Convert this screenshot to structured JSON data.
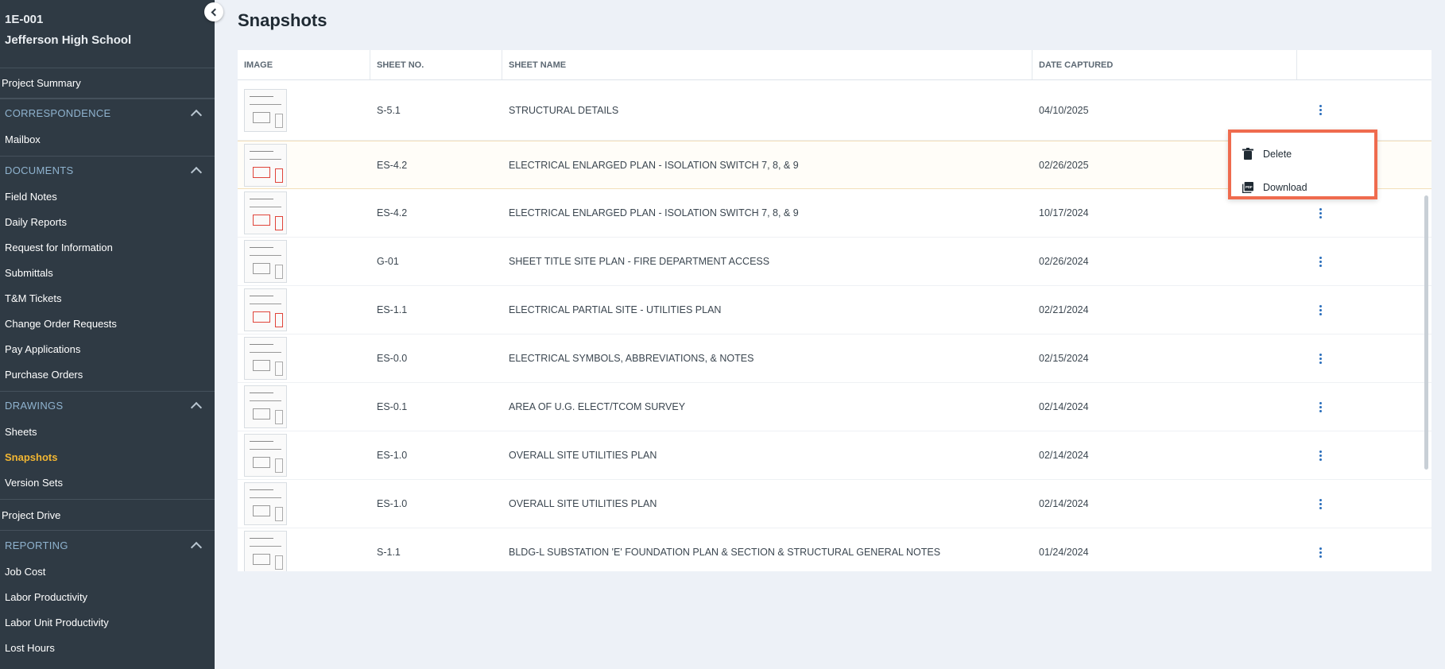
{
  "project": {
    "code": "1E-001",
    "name": "Jefferson High School"
  },
  "nav": {
    "project_summary": "Project Summary",
    "correspondence": {
      "title": "CORRESPONDENCE",
      "items": [
        "Mailbox"
      ]
    },
    "documents": {
      "title": "DOCUMENTS",
      "items": [
        "Field Notes",
        "Daily Reports",
        "Request for Information",
        "Submittals",
        "T&M Tickets",
        "Change Order Requests",
        "Pay Applications",
        "Purchase Orders"
      ]
    },
    "drawings": {
      "title": "DRAWINGS",
      "items": [
        "Sheets",
        "Snapshots",
        "Version Sets"
      ],
      "active": "Snapshots"
    },
    "project_drive": "Project Drive",
    "reporting": {
      "title": "REPORTING",
      "items": [
        "Job Cost",
        "Labor Productivity",
        "Labor Unit Productivity",
        "Lost Hours"
      ]
    }
  },
  "page": {
    "title": "Snapshots"
  },
  "table": {
    "columns": [
      "IMAGE",
      "SHEET NO.",
      "SHEET NAME",
      "DATE CAPTURED",
      ""
    ],
    "rows": [
      {
        "sheet_no": "S-5.1",
        "sheet_name": "STRUCTURAL DETAILS",
        "date": "04/10/2025"
      },
      {
        "sheet_no": "ES-4.2",
        "sheet_name": "ELECTRICAL ENLARGED PLAN - ISOLATION SWITCH 7, 8, & 9",
        "date": "02/26/2025"
      },
      {
        "sheet_no": "ES-4.2",
        "sheet_name": "ELECTRICAL ENLARGED PLAN - ISOLATION SWITCH 7, 8, & 9",
        "date": "10/17/2024"
      },
      {
        "sheet_no": "G-01",
        "sheet_name": "SHEET TITLE SITE PLAN - FIRE DEPARTMENT ACCESS",
        "date": "02/26/2024"
      },
      {
        "sheet_no": "ES-1.1",
        "sheet_name": "ELECTRICAL PARTIAL SITE - UTILITIES PLAN",
        "date": "02/21/2024"
      },
      {
        "sheet_no": "ES-0.0",
        "sheet_name": "ELECTRICAL SYMBOLS, ABBREVIATIONS, & NOTES",
        "date": "02/15/2024"
      },
      {
        "sheet_no": "ES-0.1",
        "sheet_name": "AREA OF U.G. ELECT/TCOM SURVEY",
        "date": "02/14/2024"
      },
      {
        "sheet_no": "ES-1.0",
        "sheet_name": "OVERALL SITE UTILITIES PLAN",
        "date": "02/14/2024"
      },
      {
        "sheet_no": "ES-1.0",
        "sheet_name": "OVERALL SITE UTILITIES PLAN",
        "date": "02/14/2024"
      },
      {
        "sheet_no": "S-1.1",
        "sheet_name": "BLDG-L SUBSTATION 'E' FOUNDATION PLAN & SECTION & STRUCTURAL GENERAL NOTES",
        "date": "01/24/2024"
      }
    ]
  },
  "row_menu": {
    "items": [
      {
        "label": "Delete",
        "icon": "trash-icon"
      },
      {
        "label": "Download",
        "icon": "pdf-icon"
      }
    ]
  },
  "colors": {
    "sidebar_bg": "#2f3a44",
    "active_nav": "#f2b632",
    "section_label": "#8fb3cf",
    "menu_highlight_border": "#ef6b4e",
    "kebab": "#2a6ebb"
  }
}
